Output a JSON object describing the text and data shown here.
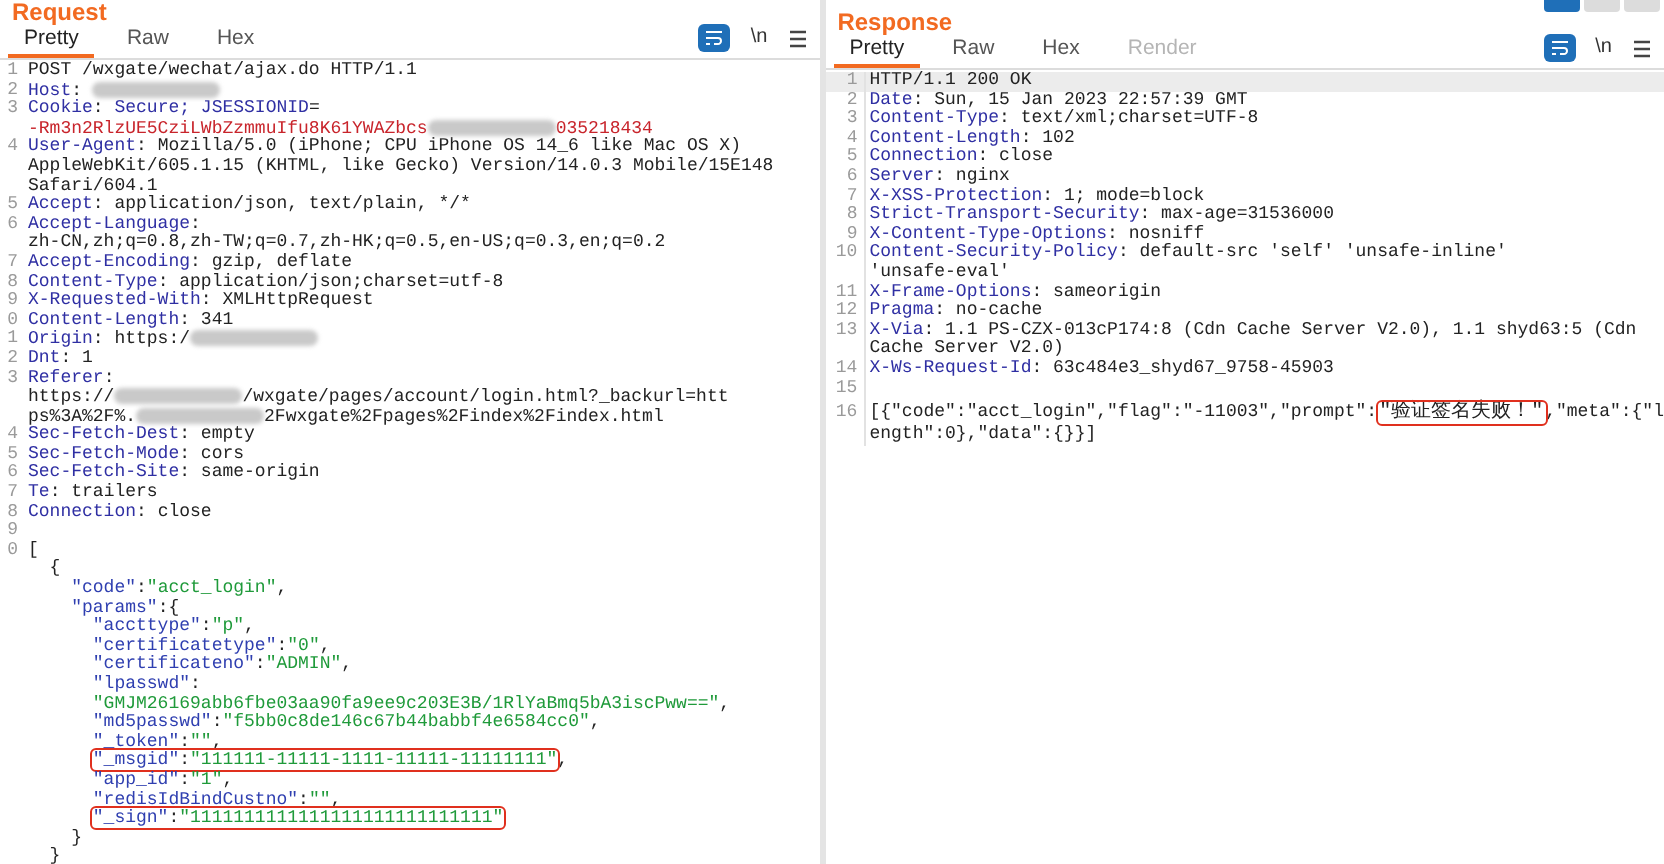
{
  "request": {
    "title": "Request",
    "tabs": [
      {
        "label": "Pretty",
        "selected": true,
        "disabled": false
      },
      {
        "label": "Raw",
        "selected": false,
        "disabled": false
      },
      {
        "label": "Hex",
        "selected": false,
        "disabled": false
      }
    ],
    "newline_toggle": "\\n",
    "lines": [
      {
        "number": "1",
        "segments": [
          {
            "kind": "text",
            "text": "POST /wxgate/wechat/ajax.do HTTP/1.1"
          }
        ]
      },
      {
        "number": "2",
        "segments": [
          {
            "kind": "key",
            "text": "Host"
          },
          {
            "kind": "text",
            "text": ": "
          },
          {
            "kind": "redacted"
          }
        ]
      },
      {
        "number": "3",
        "segments": [
          {
            "kind": "key",
            "text": "Cookie"
          },
          {
            "kind": "text",
            "text": ": "
          },
          {
            "kind": "key",
            "text": "Secure; JSESSIONID"
          },
          {
            "kind": "text",
            "text": "="
          }
        ]
      },
      {
        "segments": [
          {
            "kind": "cookie",
            "text": "-Rm3n2RlzUE5CziLWbZzmmuIfu8K61YWAZbcs"
          },
          {
            "kind": "redacted"
          },
          {
            "kind": "cookie",
            "text": "035218434"
          }
        ]
      },
      {
        "number": "4",
        "segments": [
          {
            "kind": "key",
            "text": "User-Agent"
          },
          {
            "kind": "text",
            "text": ": Mozilla/5.0 (iPhone; CPU iPhone OS 14_6 like Mac OS X)"
          }
        ]
      },
      {
        "segments": [
          {
            "kind": "text",
            "text": "AppleWebKit/605.1.15 (KHTML, like Gecko) Version/14.0.3 Mobile/15E148"
          }
        ]
      },
      {
        "segments": [
          {
            "kind": "text",
            "text": "Safari/604.1"
          }
        ]
      },
      {
        "number": "5",
        "segments": [
          {
            "kind": "key",
            "text": "Accept"
          },
          {
            "kind": "text",
            "text": ": application/json, text/plain, */*"
          }
        ]
      },
      {
        "number": "6",
        "segments": [
          {
            "kind": "key",
            "text": "Accept-Language"
          },
          {
            "kind": "text",
            "text": ":"
          }
        ]
      },
      {
        "segments": [
          {
            "kind": "text",
            "text": "zh-CN,zh;q=0.8,zh-TW;q=0.7,zh-HK;q=0.5,en-US;q=0.3,en;q=0.2"
          }
        ]
      },
      {
        "number": "7",
        "segments": [
          {
            "kind": "key",
            "text": "Accept-Encoding"
          },
          {
            "kind": "text",
            "text": ": gzip, deflate"
          }
        ]
      },
      {
        "number": "8",
        "segments": [
          {
            "kind": "key",
            "text": "Content-Type"
          },
          {
            "kind": "text",
            "text": ": application/json;charset=utf-8"
          }
        ]
      },
      {
        "number": "9",
        "segments": [
          {
            "kind": "key",
            "text": "X-Requested-With"
          },
          {
            "kind": "text",
            "text": ": XMLHttpRequest"
          }
        ]
      },
      {
        "number": "0",
        "segments": [
          {
            "kind": "key",
            "text": "Content-Length"
          },
          {
            "kind": "text",
            "text": ": 341"
          }
        ]
      },
      {
        "number": "1",
        "segments": [
          {
            "kind": "key",
            "text": "Origin"
          },
          {
            "kind": "text",
            "text": ": https:/"
          },
          {
            "kind": "redacted"
          }
        ]
      },
      {
        "number": "2",
        "segments": [
          {
            "kind": "key",
            "text": "Dnt"
          },
          {
            "kind": "text",
            "text": ": 1"
          }
        ]
      },
      {
        "number": "3",
        "segments": [
          {
            "kind": "key",
            "text": "Referer"
          },
          {
            "kind": "text",
            "text": ":"
          }
        ]
      },
      {
        "segments": [
          {
            "kind": "text",
            "text": "https://"
          },
          {
            "kind": "redacted"
          },
          {
            "kind": "text",
            "text": "/wxgate/pages/account/login.html?_backurl=htt"
          }
        ]
      },
      {
        "segments": [
          {
            "kind": "text",
            "text": "ps%3A%2F%."
          },
          {
            "kind": "redacted"
          },
          {
            "kind": "text",
            "text": "2Fwxgate%2Fpages%2Findex%2Findex.html"
          }
        ]
      },
      {
        "number": "4",
        "segments": [
          {
            "kind": "key",
            "text": "Sec-Fetch-Dest"
          },
          {
            "kind": "text",
            "text": ": empty"
          }
        ]
      },
      {
        "number": "5",
        "segments": [
          {
            "kind": "key",
            "text": "Sec-Fetch-Mode"
          },
          {
            "kind": "text",
            "text": ": cors"
          }
        ]
      },
      {
        "number": "6",
        "segments": [
          {
            "kind": "key",
            "text": "Sec-Fetch-Site"
          },
          {
            "kind": "text",
            "text": ": same-origin"
          }
        ]
      },
      {
        "number": "7",
        "segments": [
          {
            "kind": "key",
            "text": "Te"
          },
          {
            "kind": "text",
            "text": ": trailers"
          }
        ]
      },
      {
        "number": "8",
        "segments": [
          {
            "kind": "key",
            "text": "Connection"
          },
          {
            "kind": "text",
            "text": ": close"
          }
        ]
      },
      {
        "number": "9"
      },
      {
        "number": "0",
        "segments": [
          {
            "kind": "text",
            "text": "["
          }
        ]
      },
      {
        "segments": [
          {
            "kind": "text",
            "text": "  {"
          }
        ]
      },
      {
        "segments": [
          {
            "kind": "jkey",
            "text": "    \"code\""
          },
          {
            "kind": "text",
            "text": ":"
          },
          {
            "kind": "string",
            "text": "\"acct_login\""
          },
          {
            "kind": "text",
            "text": ","
          }
        ]
      },
      {
        "segments": [
          {
            "kind": "jkey",
            "text": "    \"params\""
          },
          {
            "kind": "text",
            "text": ":{"
          }
        ]
      },
      {
        "segments": [
          {
            "kind": "jkey",
            "text": "      \"accttype\""
          },
          {
            "kind": "text",
            "text": ":"
          },
          {
            "kind": "string",
            "text": "\"p\""
          },
          {
            "kind": "text",
            "text": ","
          }
        ]
      },
      {
        "segments": [
          {
            "kind": "jkey",
            "text": "      \"certificatetype\""
          },
          {
            "kind": "text",
            "text": ":"
          },
          {
            "kind": "string",
            "text": "\"0\""
          },
          {
            "kind": "text",
            "text": ","
          }
        ]
      },
      {
        "segments": [
          {
            "kind": "jkey",
            "text": "      \"certificateno\""
          },
          {
            "kind": "text",
            "text": ":"
          },
          {
            "kind": "string",
            "text": "\"ADMIN\""
          },
          {
            "kind": "text",
            "text": ","
          }
        ]
      },
      {
        "segments": [
          {
            "kind": "jkey",
            "text": "      \"lpasswd\""
          },
          {
            "kind": "text",
            "text": ":"
          }
        ]
      },
      {
        "segments": [
          {
            "kind": "string",
            "text": "      \"GMJM26169abb6fbe03aa90fa9ee9c203E3B/1RlYaBmq5bA3iscPww==\""
          },
          {
            "kind": "text",
            "text": ","
          }
        ]
      },
      {
        "segments": [
          {
            "kind": "jkey",
            "text": "      \"md5passwd\""
          },
          {
            "kind": "text",
            "text": ":"
          },
          {
            "kind": "string",
            "text": "\"f5bb0c8de146c67b44babbf4e6584cc0\""
          },
          {
            "kind": "text",
            "text": ","
          }
        ]
      },
      {
        "segments": [
          {
            "kind": "jkey",
            "text": "      \"_token\""
          },
          {
            "kind": "text",
            "text": ":"
          },
          {
            "kind": "string",
            "text": "\"\""
          },
          {
            "kind": "text",
            "text": ","
          }
        ]
      },
      {
        "segments": [
          {
            "kind": "box",
            "parts": [
              {
                "kind": "jkey",
                "text": "      \"_msgid\""
              },
              {
                "kind": "text",
                "text": ":"
              },
              {
                "kind": "string",
                "text": "\"111111-11111-1111-11111-11111111\""
              }
            ]
          },
          {
            "kind": "text",
            "text": ","
          }
        ]
      },
      {
        "segments": [
          {
            "kind": "jkey",
            "text": "      \"app_id\""
          },
          {
            "kind": "text",
            "text": ":"
          },
          {
            "kind": "string",
            "text": "\"1\""
          },
          {
            "kind": "text",
            "text": ","
          }
        ]
      },
      {
        "segments": [
          {
            "kind": "jkey",
            "text": "      \"redisIdBindCustno\""
          },
          {
            "kind": "text",
            "text": ":"
          },
          {
            "kind": "string",
            "text": "\"\""
          },
          {
            "kind": "text",
            "text": ","
          }
        ]
      },
      {
        "segments": [
          {
            "kind": "box",
            "parts": [
              {
                "kind": "jkey",
                "text": "      \"_sign\""
              },
              {
                "kind": "text",
                "text": ":"
              },
              {
                "kind": "string",
                "text": "\"1111111111111111111111111111\""
              }
            ]
          }
        ]
      },
      {
        "segments": [
          {
            "kind": "text",
            "text": "    }"
          }
        ]
      },
      {
        "segments": [
          {
            "kind": "text",
            "text": "  }"
          }
        ]
      }
    ]
  },
  "response": {
    "title": "Response",
    "tabs": [
      {
        "label": "Pretty",
        "selected": true,
        "disabled": false
      },
      {
        "label": "Raw",
        "selected": false,
        "disabled": false
      },
      {
        "label": "Hex",
        "selected": false,
        "disabled": false
      },
      {
        "label": "Render",
        "selected": false,
        "disabled": true
      }
    ],
    "newline_toggle": "\\n",
    "layout_buttons": [
      {
        "selected": true
      },
      {
        "selected": false
      },
      {
        "selected": false
      }
    ],
    "lines": [
      {
        "number": "1",
        "current": true,
        "segments": [
          {
            "kind": "text",
            "text": "HTTP/1.1 200 OK"
          }
        ]
      },
      {
        "number": "2",
        "current": false,
        "segments": [
          {
            "kind": "key",
            "text": "Date"
          },
          {
            "kind": "text",
            "text": ": Sun, 15 Jan 2023 22:57:39 GMT"
          }
        ]
      },
      {
        "number": "3",
        "current": false,
        "segments": [
          {
            "kind": "key",
            "text": "Content-Type"
          },
          {
            "kind": "text",
            "text": ": text/xml;charset=UTF-8"
          }
        ]
      },
      {
        "number": "4",
        "current": false,
        "segments": [
          {
            "kind": "key",
            "text": "Content-Length"
          },
          {
            "kind": "text",
            "text": ": 102"
          }
        ]
      },
      {
        "number": "5",
        "current": false,
        "segments": [
          {
            "kind": "key",
            "text": "Connection"
          },
          {
            "kind": "text",
            "text": ": close"
          }
        ]
      },
      {
        "number": "6",
        "current": false,
        "segments": [
          {
            "kind": "key",
            "text": "Server"
          },
          {
            "kind": "text",
            "text": ": nginx"
          }
        ]
      },
      {
        "number": "7",
        "current": false,
        "segments": [
          {
            "kind": "key",
            "text": "X-XSS-Protection"
          },
          {
            "kind": "text",
            "text": ": 1; mode=block"
          }
        ]
      },
      {
        "number": "8",
        "current": false,
        "segments": [
          {
            "kind": "key",
            "text": "Strict-Transport-Security"
          },
          {
            "kind": "text",
            "text": ": max-age=31536000"
          }
        ]
      },
      {
        "number": "9",
        "current": false,
        "segments": [
          {
            "kind": "key",
            "text": "X-Content-Type-Options"
          },
          {
            "kind": "text",
            "text": ": nosniff"
          }
        ]
      },
      {
        "number": "10",
        "current": false,
        "segments": [
          {
            "kind": "key",
            "text": "Content-Security-Policy"
          },
          {
            "kind": "text",
            "text": ": default-src 'self' 'unsafe-inline'"
          }
        ]
      },
      {
        "current": false,
        "segments": [
          {
            "kind": "text",
            "text": "'unsafe-eval'"
          }
        ]
      },
      {
        "number": "11",
        "current": false,
        "segments": [
          {
            "kind": "key",
            "text": "X-Frame-Options"
          },
          {
            "kind": "text",
            "text": ": sameorigin"
          }
        ]
      },
      {
        "number": "12",
        "current": false,
        "segments": [
          {
            "kind": "key",
            "text": "Pragma"
          },
          {
            "kind": "text",
            "text": ": no-cache"
          }
        ]
      },
      {
        "number": "13",
        "current": false,
        "segments": [
          {
            "kind": "key",
            "text": "X-Via"
          },
          {
            "kind": "text",
            "text": ": 1.1 PS-CZX-013cP174:8 (Cdn Cache Server V2.0), 1.1 shyd63:5 (Cdn"
          }
        ]
      },
      {
        "current": false,
        "segments": [
          {
            "kind": "text",
            "text": "Cache Server V2.0)"
          }
        ]
      },
      {
        "number": "14",
        "current": false,
        "segments": [
          {
            "kind": "key",
            "text": "X-Ws-Request-Id"
          },
          {
            "kind": "text",
            "text": ": 63c484e3_shyd67_9758-45903"
          }
        ]
      },
      {
        "number": "15",
        "current": false
      },
      {
        "number": "16",
        "current": false,
        "segments": [
          {
            "kind": "text",
            "text": "[{\"code\":\"acct_login\",\"flag\":\"-11003\",\"prompt\":"
          },
          {
            "kind": "box",
            "parts": [
              {
                "kind": "text",
                "text": "\"验证签名失败！\""
              }
            ]
          },
          {
            "kind": "text",
            "text": ",\"meta\":{\"l"
          }
        ]
      },
      {
        "current": false,
        "segments": [
          {
            "kind": "text",
            "text": "ength\":0},\"data\":{}}]"
          }
        ]
      }
    ]
  }
}
